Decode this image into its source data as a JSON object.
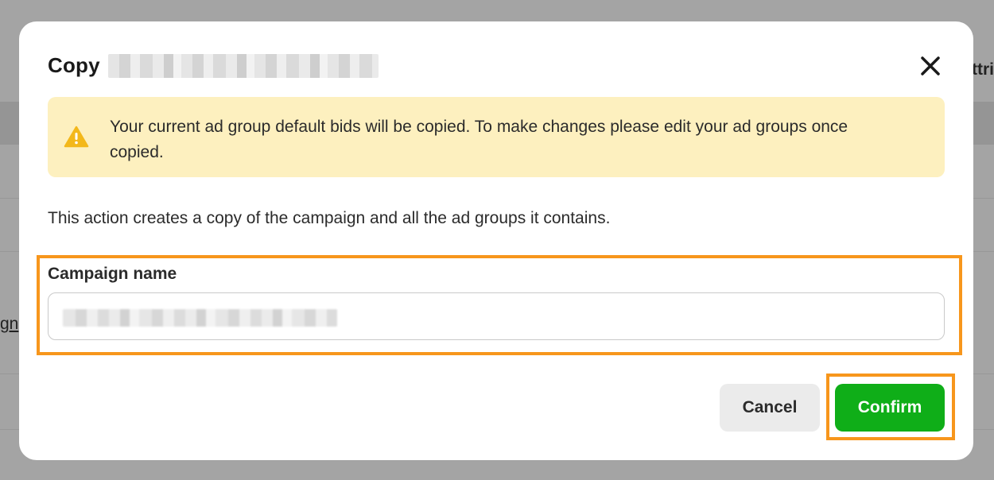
{
  "background": {
    "right_fragment": "ttri",
    "left_fragment": "gn"
  },
  "dialog": {
    "title": "Copy",
    "close_icon": "close-icon",
    "alert": {
      "icon": "warning-icon",
      "text": "Your current ad group default bids will be copied. To make changes please edit your ad groups once copied."
    },
    "description": "This action creates a copy of the campaign and all the ad groups it contains.",
    "field": {
      "label": "Campaign name",
      "value": ""
    },
    "buttons": {
      "cancel": "Cancel",
      "confirm": "Confirm"
    }
  },
  "colors": {
    "highlight": "#f7961c",
    "confirm": "#0fae18",
    "alert_bg": "#fdf0bf",
    "warning": "#f3b81b"
  }
}
